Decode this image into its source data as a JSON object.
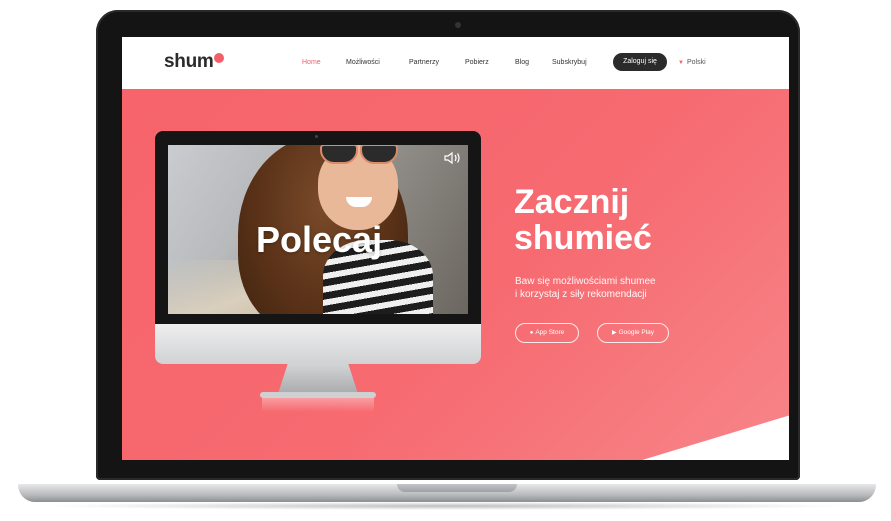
{
  "header": {
    "logo": "shum",
    "nav_items": [
      {
        "label": "Home",
        "active": true
      },
      {
        "label": "Możliwości"
      },
      {
        "label": "Partnerzy"
      },
      {
        "label": "Pobierz"
      },
      {
        "label": "Blog"
      },
      {
        "label": "Subskrybuj"
      }
    ],
    "login_label": "Zaloguj się",
    "language": "Polski"
  },
  "hero": {
    "video_overlay_text": "Polecaj",
    "heading_line1": "Zacznij",
    "heading_line2": "shumieć",
    "subtitle_line1": "Baw się możliwościami shumee",
    "subtitle_line2": "i korzystaj z siły rekomendacji",
    "app_store_label": "App Store",
    "google_play_label": "Google Play"
  },
  "colors": {
    "accent": "#f35e6a",
    "hero_background": "#f7646b",
    "dark_button": "#2b2b2b"
  },
  "icons": {
    "apple": "apple-icon",
    "google_play": "google-play-icon",
    "speaker": "speaker-icon",
    "lang_arrow": "chevron-down-icon"
  }
}
